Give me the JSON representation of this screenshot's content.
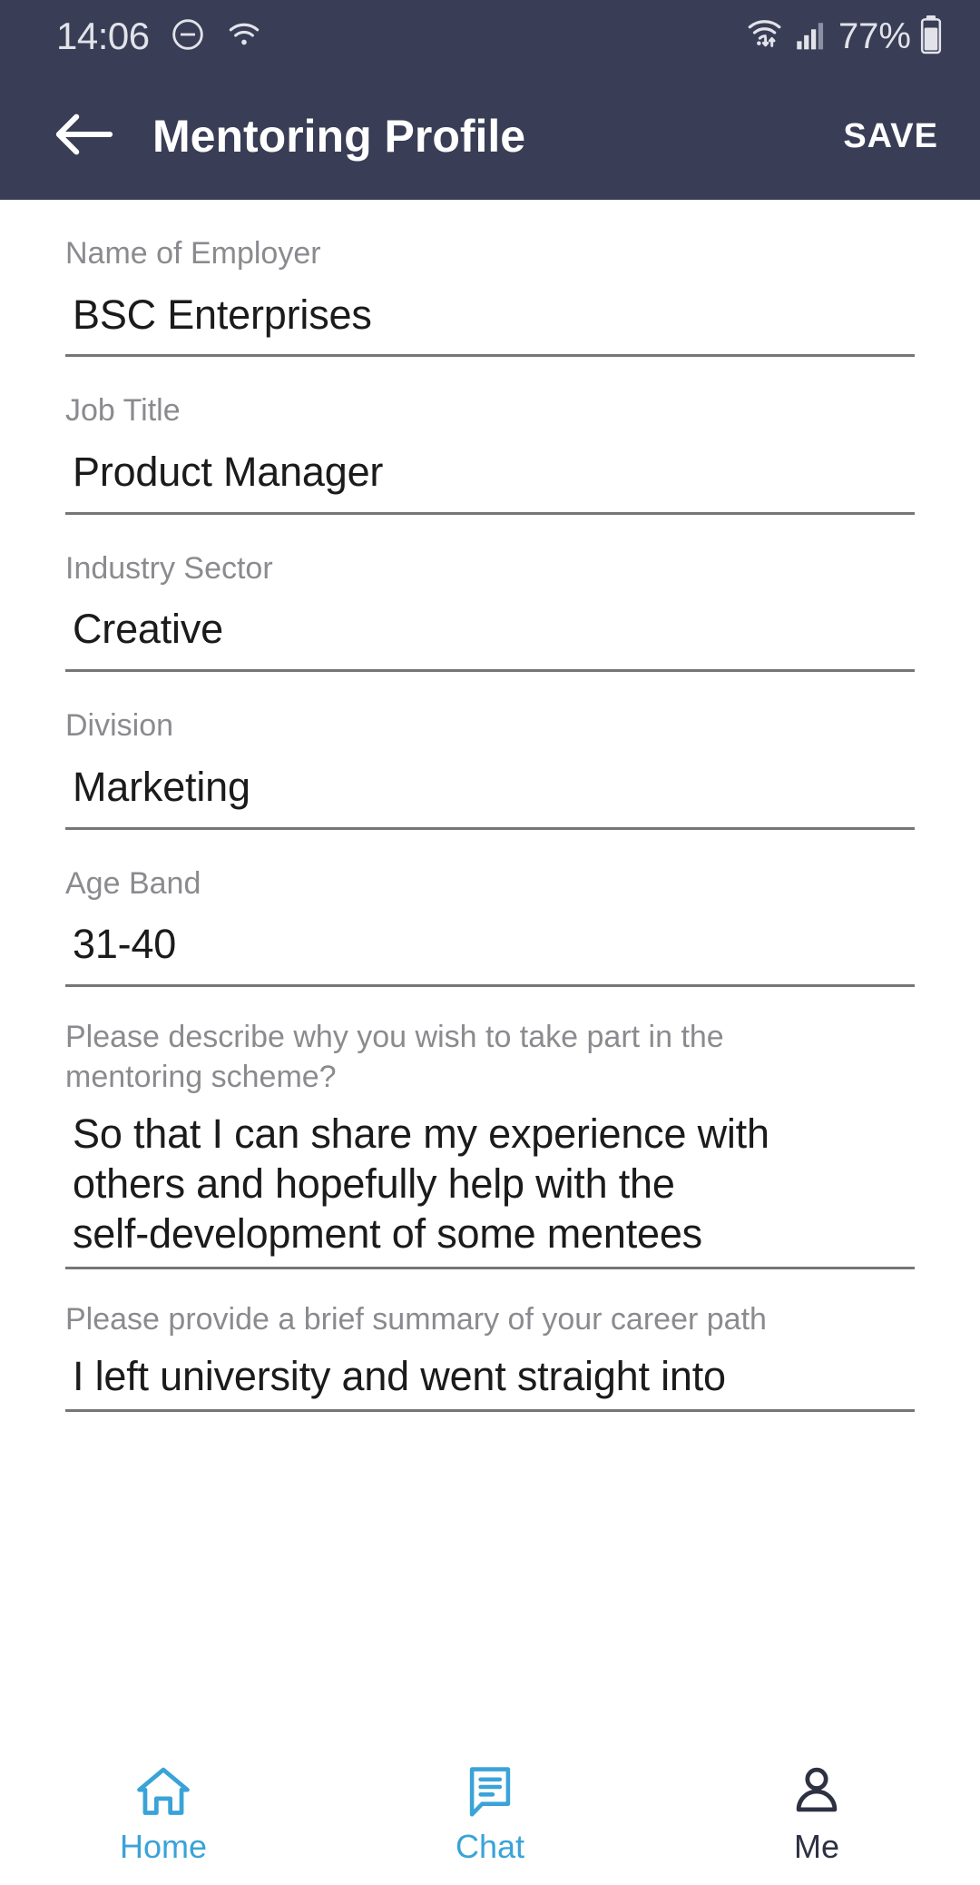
{
  "status_bar": {
    "time": "14:06",
    "battery_percent": "77%",
    "icons": {
      "dnd": "do-not-disturb-icon",
      "wifi_left": "wifi-icon",
      "wifi_right": "wifi-data-transfer-icon",
      "signal": "cellular-signal-icon",
      "battery": "battery-icon"
    },
    "signal_bars_filled": 3,
    "signal_bars_total": 4,
    "colors": {
      "background": "#393D55",
      "foreground": "#E2E3EA"
    }
  },
  "app_bar": {
    "back_label": "back-arrow-icon",
    "title": "Mentoring Profile",
    "save_label": "SAVE",
    "background": "#393D55"
  },
  "form": {
    "fields": [
      {
        "label": "Name of Employer",
        "value": "BSC Enterprises",
        "type": "text"
      },
      {
        "label": "Job Title",
        "value": "Product Manager",
        "type": "text"
      },
      {
        "label": "Industry Sector",
        "value": "Creative",
        "type": "text"
      },
      {
        "label": "Division",
        "value": "Marketing",
        "type": "text"
      },
      {
        "label": "Age Band",
        "value": "31-40",
        "type": "text"
      }
    ],
    "questions": [
      {
        "label_line1": "Please describe why you wish to take part in the",
        "label_line2": "mentoring scheme?",
        "value_line1": "So that I can share my experience with",
        "value_line2": "others and hopefully help with the",
        "value_line3": "self-development of some mentees"
      },
      {
        "label_line1": "Please provide a brief summary of your career path",
        "value_line1": "I left university and went straight into"
      }
    ]
  },
  "bottom_nav": {
    "items": [
      {
        "label": "Home",
        "icon": "home-icon",
        "active": true
      },
      {
        "label": "Chat",
        "icon": "chat-bubble-icon",
        "active": true
      },
      {
        "label": "Me",
        "icon": "person-icon",
        "active": false
      }
    ],
    "active_color": "#3AA3D8",
    "inactive_color": "#2E3142"
  }
}
